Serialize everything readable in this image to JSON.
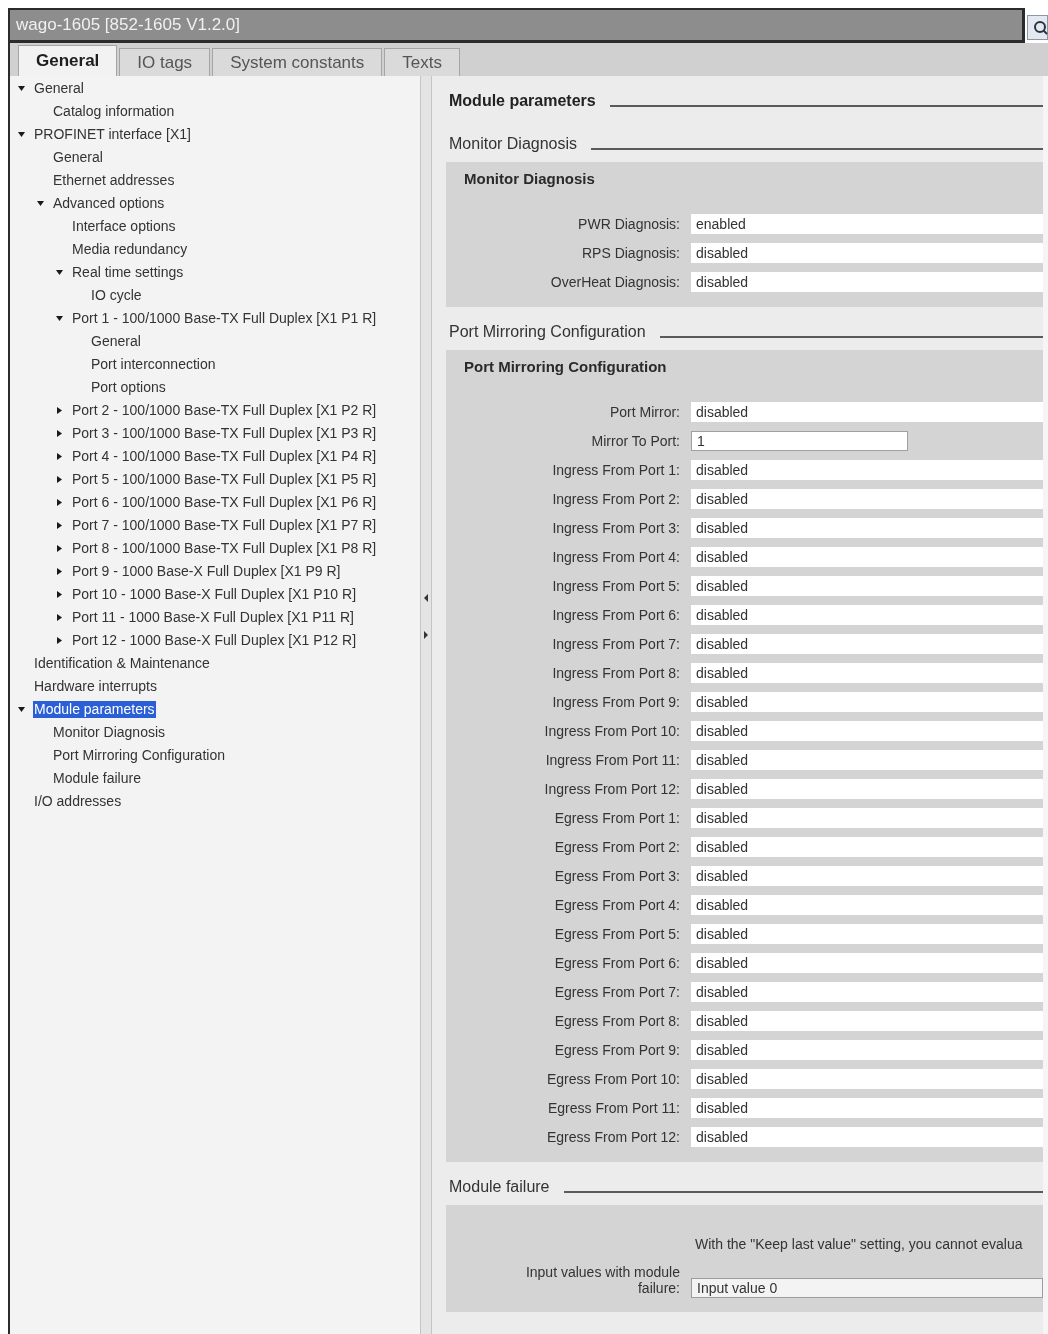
{
  "window": {
    "title": "wago-1605 [852-1605 V1.2.0]"
  },
  "tabs": [
    {
      "label": "General",
      "selected": true
    },
    {
      "label": "IO tags",
      "selected": false
    },
    {
      "label": "System constants",
      "selected": false
    },
    {
      "label": "Texts",
      "selected": false
    }
  ],
  "tree": [
    {
      "label": "General",
      "expanded": true,
      "selected": false,
      "children": [
        {
          "label": "Catalog information",
          "selected": false
        }
      ]
    },
    {
      "label": "PROFINET interface [X1]",
      "expanded": true,
      "selected": false,
      "children": [
        {
          "label": "General",
          "selected": false
        },
        {
          "label": "Ethernet addresses",
          "selected": false
        },
        {
          "label": "Advanced options",
          "expanded": true,
          "selected": false,
          "children": [
            {
              "label": "Interface options",
              "selected": false
            },
            {
              "label": "Media redundancy",
              "selected": false
            },
            {
              "label": "Real time settings",
              "expanded": true,
              "selected": false,
              "children": [
                {
                  "label": "IO cycle",
                  "selected": false
                }
              ]
            },
            {
              "label": "Port 1 - 100/1000 Base-TX Full Duplex [X1 P1 R]",
              "expanded": true,
              "selected": false,
              "children": [
                {
                  "label": "General",
                  "selected": false
                },
                {
                  "label": "Port interconnection",
                  "selected": false
                },
                {
                  "label": "Port options",
                  "selected": false
                }
              ]
            },
            {
              "label": "Port 2 - 100/1000 Base-TX Full Duplex [X1 P2 R]",
              "expanded": false,
              "selected": false
            },
            {
              "label": "Port 3 - 100/1000 Base-TX Full Duplex [X1 P3 R]",
              "expanded": false,
              "selected": false
            },
            {
              "label": "Port 4 - 100/1000 Base-TX Full Duplex [X1 P4 R]",
              "expanded": false,
              "selected": false
            },
            {
              "label": "Port 5 - 100/1000 Base-TX Full Duplex [X1 P5 R]",
              "expanded": false,
              "selected": false
            },
            {
              "label": "Port 6 - 100/1000 Base-TX Full Duplex [X1 P6 R]",
              "expanded": false,
              "selected": false
            },
            {
              "label": "Port 7 - 100/1000 Base-TX Full Duplex [X1 P7 R]",
              "expanded": false,
              "selected": false
            },
            {
              "label": "Port 8 - 100/1000 Base-TX Full Duplex [X1 P8 R]",
              "expanded": false,
              "selected": false
            },
            {
              "label": "Port 9 - 1000 Base-X Full Duplex [X1 P9 R]",
              "expanded": false,
              "selected": false
            },
            {
              "label": "Port 10 - 1000 Base-X Full Duplex [X1 P10 R]",
              "expanded": false,
              "selected": false
            },
            {
              "label": "Port 11 - 1000 Base-X Full Duplex [X1 P11 R]",
              "expanded": false,
              "selected": false
            },
            {
              "label": "Port 12 - 1000 Base-X Full Duplex [X1 P12 R]",
              "expanded": false,
              "selected": false
            }
          ]
        }
      ]
    },
    {
      "label": "Identification & Maintenance",
      "selected": false
    },
    {
      "label": "Hardware interrupts",
      "selected": false
    },
    {
      "label": "Module parameters",
      "expanded": true,
      "selected": true,
      "children": [
        {
          "label": "Monitor Diagnosis",
          "selected": false
        },
        {
          "label": "Port Mirroring Configuration",
          "selected": false
        },
        {
          "label": "Module failure",
          "selected": false
        }
      ]
    },
    {
      "label": "I/O addresses",
      "selected": false
    }
  ],
  "content": {
    "title": "Module parameters",
    "sections": [
      {
        "heading": "Monitor Diagnosis",
        "panel_title": "Monitor Diagnosis",
        "fields": [
          {
            "label": "PWR Diagnosis:",
            "value": "enabled",
            "kind": "select"
          },
          {
            "label": "RPS Diagnosis:",
            "value": "disabled",
            "kind": "select"
          },
          {
            "label": "OverHeat Diagnosis:",
            "value": "disabled",
            "kind": "select"
          }
        ]
      },
      {
        "heading": "Port Mirroring Configuration",
        "panel_title": "Port Mirroring Configuration",
        "fields": [
          {
            "label": "Port Mirror:",
            "value": "disabled",
            "kind": "select"
          },
          {
            "label": "Mirror To Port:",
            "value": "1",
            "kind": "number"
          },
          {
            "label": "Ingress From Port 1:",
            "value": "disabled",
            "kind": "select"
          },
          {
            "label": "Ingress From Port 2:",
            "value": "disabled",
            "kind": "select"
          },
          {
            "label": "Ingress From Port 3:",
            "value": "disabled",
            "kind": "select"
          },
          {
            "label": "Ingress From Port 4:",
            "value": "disabled",
            "kind": "select"
          },
          {
            "label": "Ingress From Port 5:",
            "value": "disabled",
            "kind": "select"
          },
          {
            "label": "Ingress From Port 6:",
            "value": "disabled",
            "kind": "select"
          },
          {
            "label": "Ingress From Port 7:",
            "value": "disabled",
            "kind": "select"
          },
          {
            "label": "Ingress From Port 8:",
            "value": "disabled",
            "kind": "select"
          },
          {
            "label": "Ingress From Port 9:",
            "value": "disabled",
            "kind": "select"
          },
          {
            "label": "Ingress From Port 10:",
            "value": "disabled",
            "kind": "select"
          },
          {
            "label": "Ingress From Port 11:",
            "value": "disabled",
            "kind": "select"
          },
          {
            "label": "Ingress From Port 12:",
            "value": "disabled",
            "kind": "select"
          },
          {
            "label": "Egress From Port 1:",
            "value": "disabled",
            "kind": "select"
          },
          {
            "label": "Egress From Port 2:",
            "value": "disabled",
            "kind": "select"
          },
          {
            "label": "Egress From Port 3:",
            "value": "disabled",
            "kind": "select"
          },
          {
            "label": "Egress From Port 4:",
            "value": "disabled",
            "kind": "select"
          },
          {
            "label": "Egress From Port 5:",
            "value": "disabled",
            "kind": "select"
          },
          {
            "label": "Egress From Port 6:",
            "value": "disabled",
            "kind": "select"
          },
          {
            "label": "Egress From Port 7:",
            "value": "disabled",
            "kind": "select"
          },
          {
            "label": "Egress From Port 8:",
            "value": "disabled",
            "kind": "select"
          },
          {
            "label": "Egress From Port 9:",
            "value": "disabled",
            "kind": "select"
          },
          {
            "label": "Egress From Port 10:",
            "value": "disabled",
            "kind": "select"
          },
          {
            "label": "Egress From Port 11:",
            "value": "disabled",
            "kind": "select"
          },
          {
            "label": "Egress From Port 12:",
            "value": "disabled",
            "kind": "select"
          }
        ]
      },
      {
        "heading": "Module failure",
        "note": "With the \"Keep last value\" setting, you cannot evalua",
        "fields": [
          {
            "label": "Input values with module failure:",
            "value": "Input value 0",
            "kind": "framed-select"
          }
        ]
      }
    ]
  }
}
